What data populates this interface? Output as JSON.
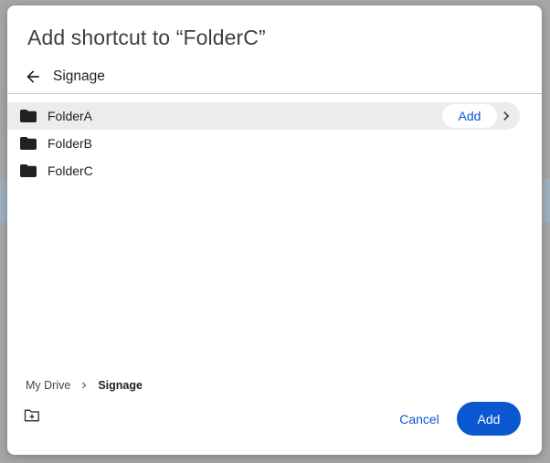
{
  "dialog": {
    "title": "Add shortcut to “FolderC”",
    "nav_title": "Signage",
    "icons": {
      "back": "arrow-left-icon",
      "folder": "folder-icon",
      "chevron": "chevron-right-icon",
      "breadcrumb_separator": "chevron-right-icon",
      "new_folder": "create-new-folder-icon"
    },
    "folders": [
      {
        "label": "FolderA",
        "selected": true,
        "add_label": "Add"
      },
      {
        "label": "FolderB",
        "selected": false
      },
      {
        "label": "FolderC",
        "selected": false
      }
    ],
    "breadcrumb": {
      "root": "My Drive",
      "current": "Signage"
    },
    "footer": {
      "cancel_label": "Cancel",
      "add_label": "Add"
    },
    "colors": {
      "accent": "#0b57d0",
      "selected_row": "#ececec",
      "text_primary": "#202124"
    }
  }
}
